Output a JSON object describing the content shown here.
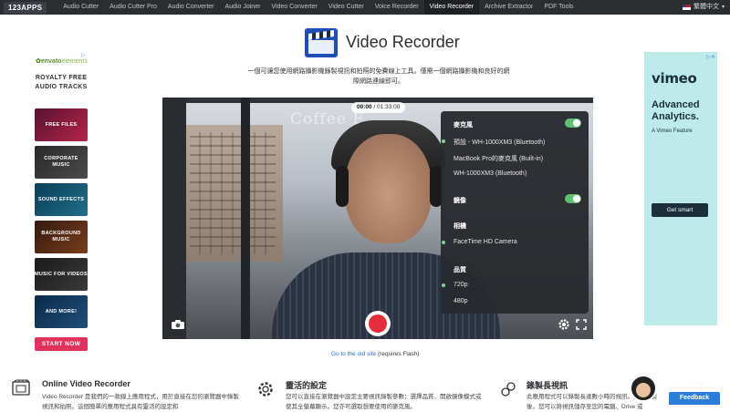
{
  "nav": {
    "logo": "123APPS",
    "links": [
      "Audio Cutter",
      "Audio Cutter Pro",
      "Audio Converter",
      "Audio Joiner",
      "Video Converter",
      "Video Cutter",
      "Voice Recorder",
      "Video Recorder",
      "Archive Extractor",
      "PDF Tools"
    ],
    "active_link": "Video Recorder",
    "language": "繁體中文"
  },
  "header": {
    "title": "Video Recorder",
    "description": "一個可讓您使用網路攝影機錄製視訊和拍照的免費線上工具。僅需一個網路攝影機和良好的網際網路連線即可。"
  },
  "ad_left": {
    "brand": "envato",
    "brand_suffix": "elements",
    "headline": "ROYALTY FREE AUDIO TRACKS",
    "tiles": [
      "FREE FILES",
      "CORPORATE MUSIC",
      "SOUND EFFECTS",
      "BACKGROUND MUSIC",
      "MUSIC FOR VIDEOS",
      "AND MORE!"
    ],
    "cta": "START NOW"
  },
  "video": {
    "overlay_text": "Coffee F",
    "elapsed": "00:00",
    "limit": "/ 01:33:00"
  },
  "settings": {
    "microphone_label": "麥克風",
    "microphone_options": [
      "預設 - WH-1000XM3 (Bluetooth)",
      "MacBook Pro的麥克風 (Built-in)",
      "WH-1000XM3 (Bluetooth)"
    ],
    "microphone_selected": "預設 - WH-1000XM3 (Bluetooth)",
    "mirror_label": "鏡像",
    "camera_label": "相機",
    "camera_options": [
      "FaceTime HD Camera"
    ],
    "quality_label": "品質",
    "quality_options": [
      "720p",
      "480p"
    ],
    "quality_selected": "720p",
    "colors": {
      "toggle_on": "#5fbf72",
      "selected_dot": "#78d88a"
    }
  },
  "old_site": {
    "link": "Go to the old site",
    "suffix": " (requires Flash)"
  },
  "ad_right": {
    "brand": "vimeo",
    "headline": "Advanced Analytics.",
    "sub": "A Vimeo Feature",
    "cta": "Get smart"
  },
  "features": [
    {
      "title": "Online Video Recorder",
      "desc": "Video Recorder 是我們的一款線上應用程式，用於直接在您的瀏覽器中錄製視訊和拍照。這個簡單的應用程式具有靈活的設定和"
    },
    {
      "title": "靈活的設定",
      "desc": "您可以直接在瀏覽器中設定主要視訊錄製參數：選擇品質、開啟鏡像模式或使其全螢幕顯示。您亦可選取想要使用的麥克風。"
    },
    {
      "title": "錄製長視訊",
      "desc": "此應用程式可以錄製長達數小時的視訊。完成錄製後，您可以將視訊儲存至您的電腦、Drive 或 Dropbox。"
    }
  ],
  "watermark": "電腦王阿達",
  "feedback": "Feedback",
  "colors": {
    "accent": "#2a7ed8",
    "record": "#e52e3c",
    "nav_bg": "#2b2d31"
  }
}
